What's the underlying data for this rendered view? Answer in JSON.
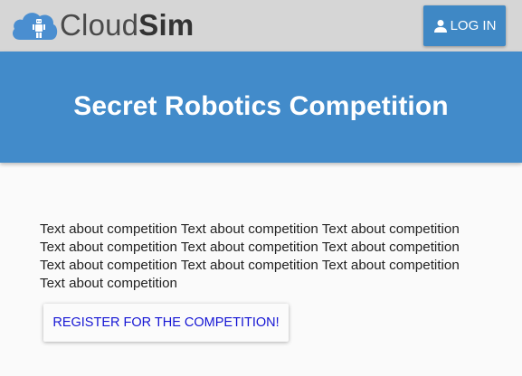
{
  "header": {
    "logo_text_light": "Cloud",
    "logo_text_bold": "Sim",
    "login_label": "LOG IN",
    "login_icon": "person-icon"
  },
  "banner": {
    "title": "Secret Robotics Competition"
  },
  "main": {
    "description": "Text about competition Text about competition Text about competition Text about competition Text about competition Text about competition Text about competition Text about competition Text about competition Text about competition",
    "register_label": "REGISTER FOR THE COMPETITION!"
  },
  "colors": {
    "topbar_bg": "#d6d6d6",
    "banner_bg": "#428bca",
    "button_primary": "#3f88c5",
    "link_blue": "#1515d4",
    "logo_cloud": "#4a8ed0"
  }
}
